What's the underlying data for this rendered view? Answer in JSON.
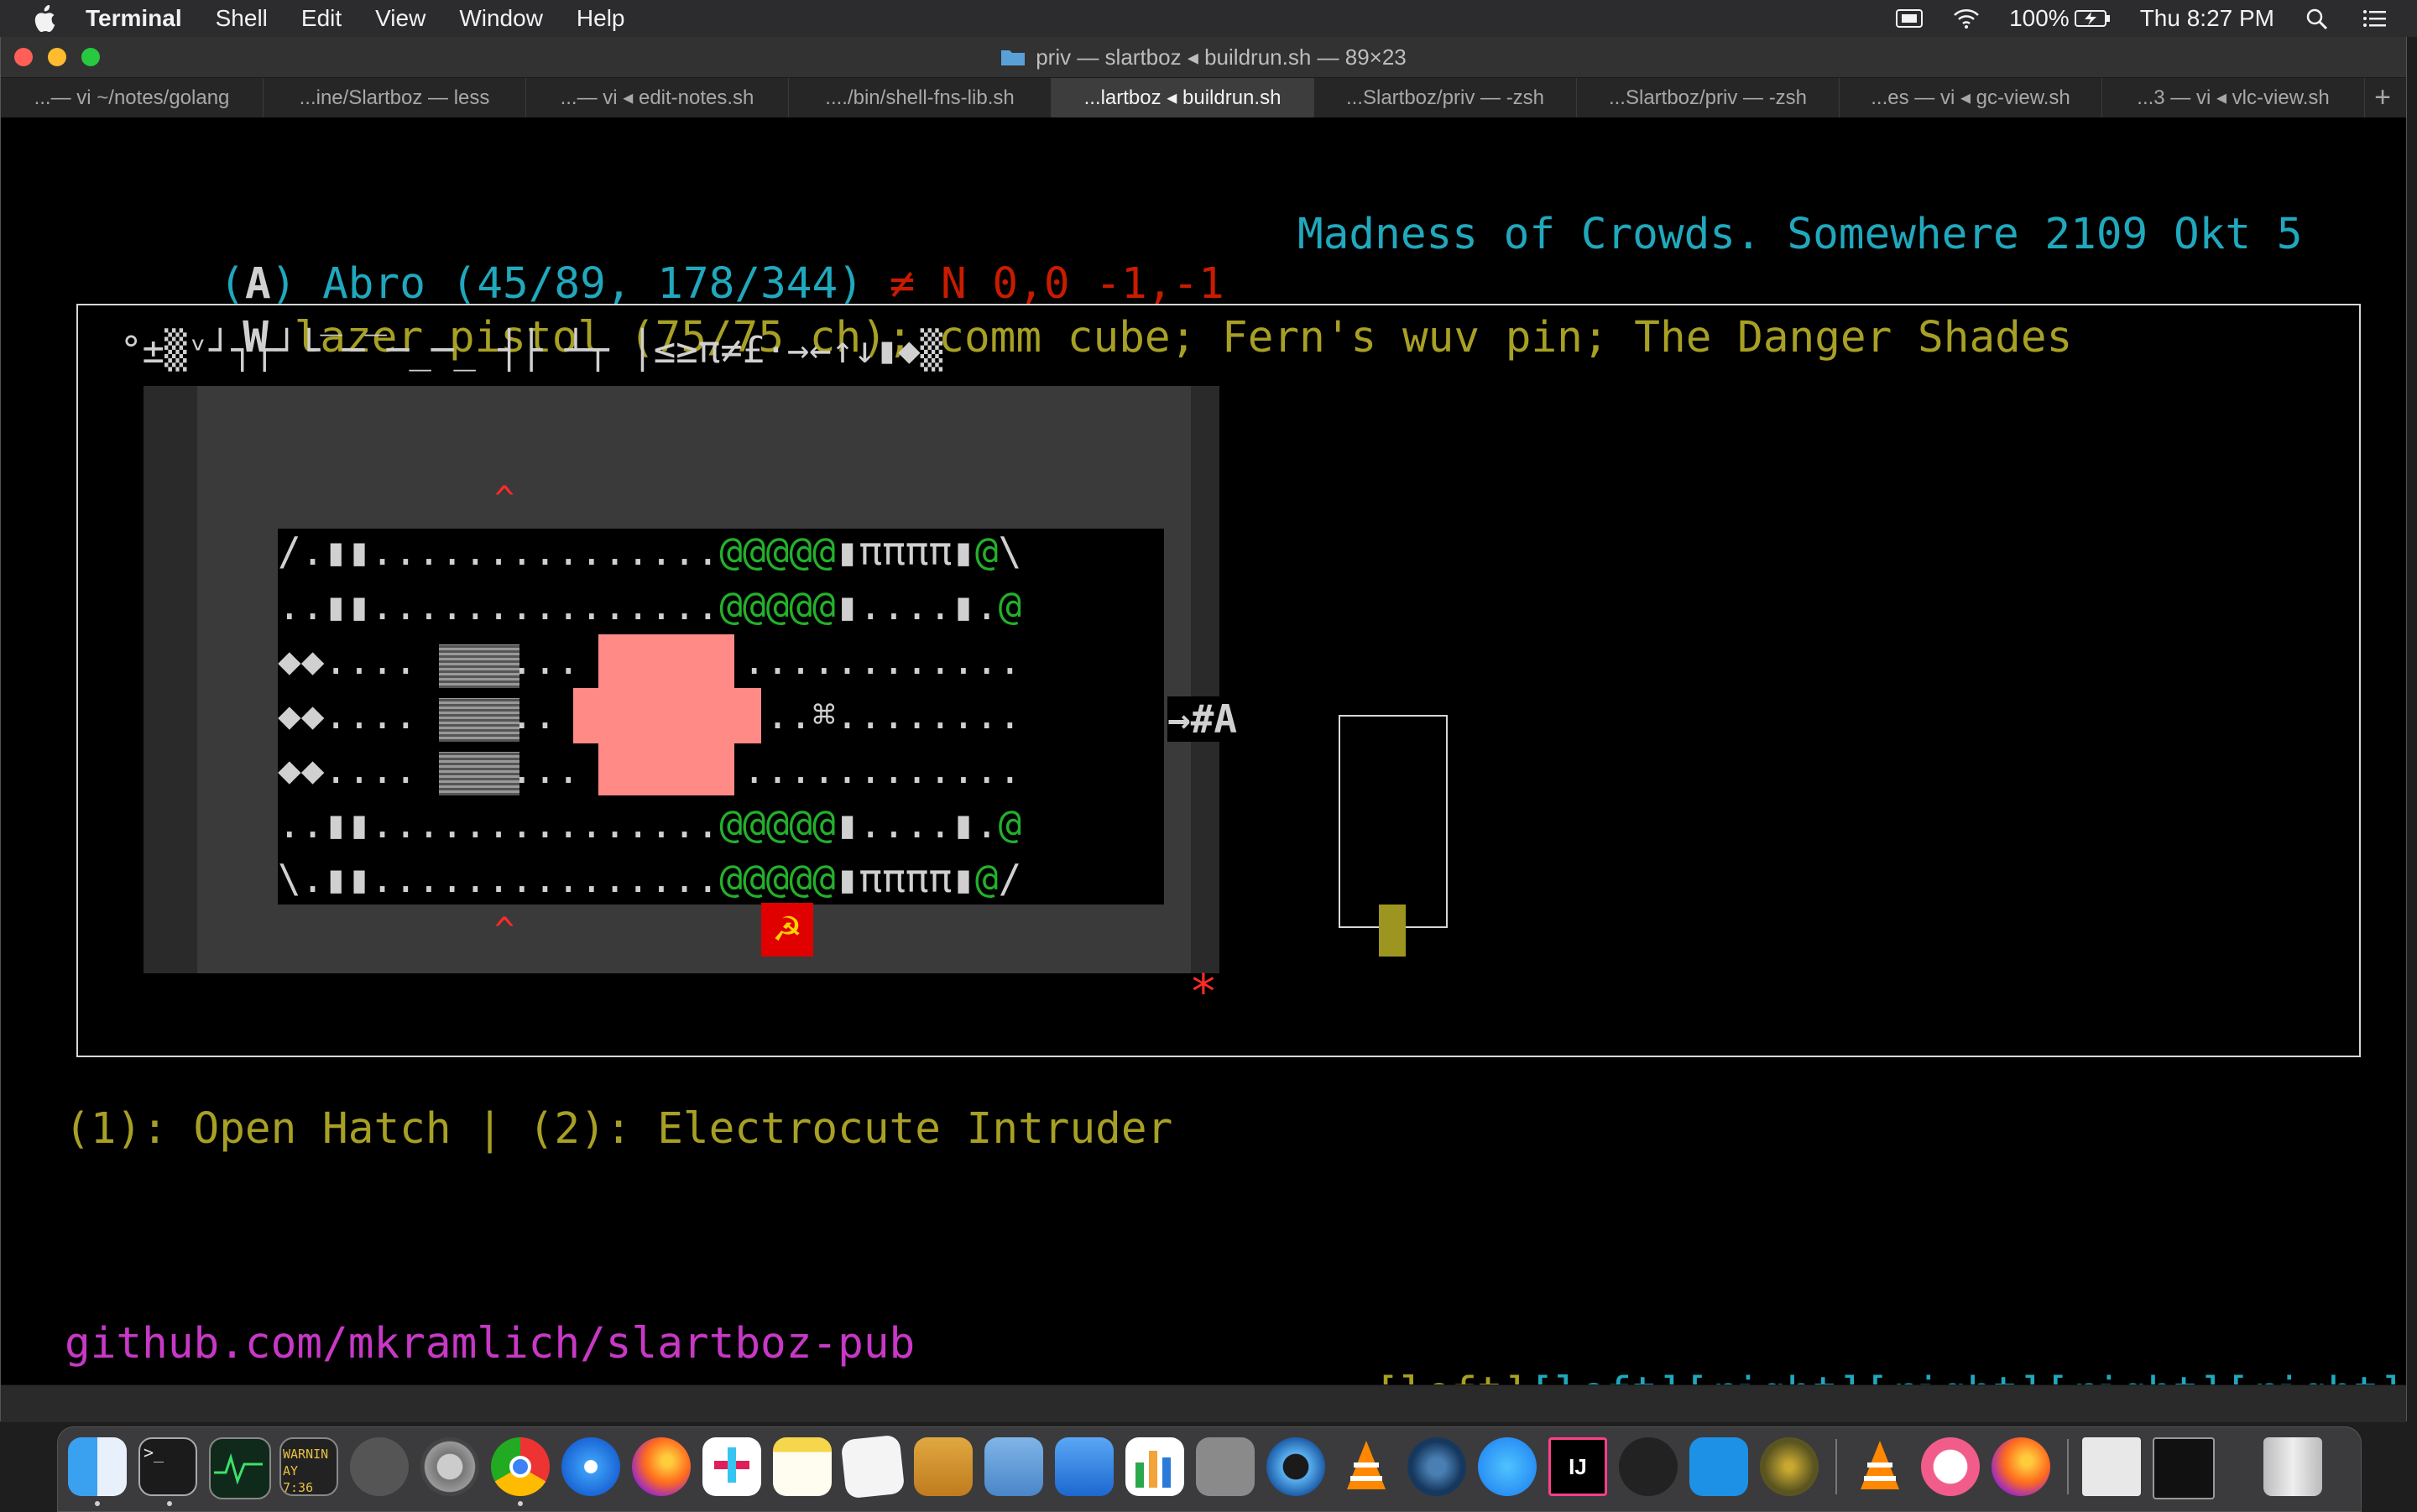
{
  "menubar": {
    "apple_icon": "apple-icon",
    "app_name": "Terminal",
    "menus": [
      "Shell",
      "Edit",
      "View",
      "Window",
      "Help"
    ],
    "battery": "100%",
    "clock": "Thu 8:27 PM"
  },
  "window": {
    "title": "priv — slartboz ◂ buildrun.sh — 89×23",
    "tabs": [
      "...— vi ~/notes/golang",
      "...ine/Slartboz — less",
      "...— vi ◂ edit-notes.sh",
      "..../bin/shell-fns-lib.sh",
      "...lartboz ◂ buildrun.sh",
      "...Slartboz/priv — -zsh",
      "...Slartboz/priv — -zsh",
      "...es — vi ◂ gc-view.sh",
      "...3 — vi ◂ vlc-view.sh"
    ],
    "active_tab": 4,
    "add_tab": "+"
  },
  "game": {
    "status": {
      "open": "(",
      "letter": "A",
      "close": ")",
      "name_pos": " Abro (45/89, 178/344) ",
      "heading": "≠ N 0,0 -1,-1",
      "story": "Madness of Crowds. Somewhere 2109 Okt 5"
    },
    "inventory": {
      "prefix": "W",
      "items": " lazer pistol (75/75 ch); comm cube; Fern's wuv pin; The Danger Shades"
    },
    "symbol_row": "°±▒ᵛ┘┐┌┘└‾─‾─_─_ ┤├ ┴┬ │≤≥π≠£·→←↑↓▮◆▒",
    "rows": [
      [
        "/.▮▮...............",
        "@@@@@",
        "▮ππππ▮",
        "@",
        "\\"
      ],
      [
        "..▮▮...............",
        "@@@@@",
        "▮....▮.",
        "@",
        ""
      ],
      [
        "◆◆....    ...     ..............",
        "",
        "",
        "",
        ""
      ],
      [
        "◆◆....    ..     |<....⌘........",
        "",
        "",
        "",
        ""
      ],
      [
        "◆◆....    ...     ..............",
        "",
        "",
        "",
        ""
      ],
      [
        "..▮▮...............",
        "@@@@@",
        "▮....▮.",
        "@",
        ""
      ],
      [
        "\\.▮▮...............",
        "@@@@@",
        "▮ππππ▮",
        "@",
        "/"
      ]
    ],
    "door_arrow": "→#A",
    "caret": "^",
    "sickle": "☭",
    "star": "*",
    "actions": "(1): Open Hatch | (2): Electrocute Intruder",
    "repo": "github.com/mkramlich/slartboz-pub",
    "keys": {
      "first": "[left]",
      "rest": "[left][right][right][right][right][rig"
    }
  },
  "dock": {
    "apps": [
      "finder-icon",
      "terminal-icon",
      "activity-monitor-icon",
      "console-icon",
      "automator-icon",
      "system-preferences-icon",
      "chrome-icon",
      "safari-icon",
      "firefox-icon",
      "slack-icon",
      "notes-icon",
      "textedit-icon",
      "preview-icon",
      "image-capture-icon",
      "keynote-icon",
      "numbers-icon",
      "calculator-icon",
      "quicktime-icon",
      "vlc-icon",
      "steam-icon",
      "app-store-icon",
      "intellij-icon",
      "inkscape-icon",
      "docker-icon",
      "radar-icon",
      "vlc-icon",
      "itunes-icon",
      "firefox-icon",
      "document-icon",
      "terminal-window-icon",
      "trash-icon"
    ],
    "console_text": "WARNIN",
    "console_text2": "AY 7:36",
    "terminal_prompt": ">_",
    "intellij_text": "IJ"
  }
}
